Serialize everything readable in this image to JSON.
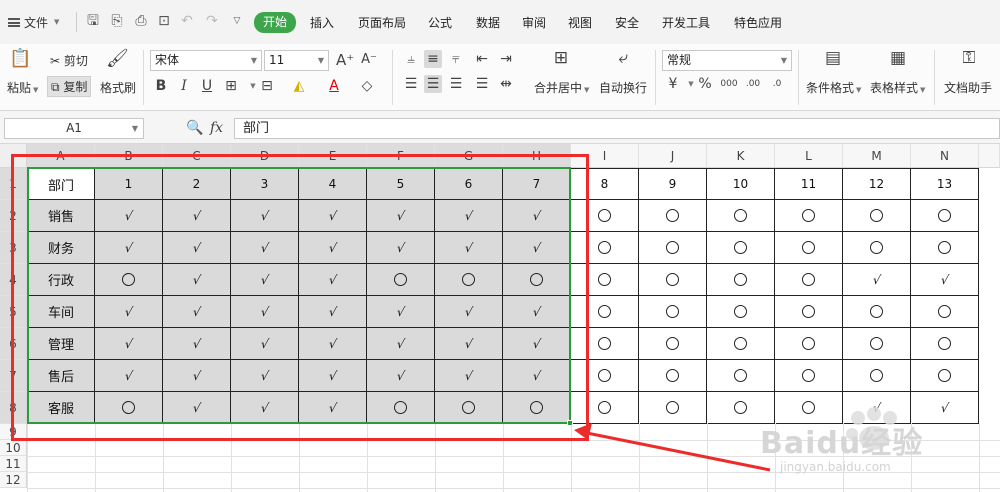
{
  "menubar": {
    "file_label": "文件",
    "tabs": [
      "开始",
      "插入",
      "页面布局",
      "公式",
      "数据",
      "审阅",
      "视图",
      "安全",
      "开发工具",
      "特色应用"
    ],
    "active_tab": "开始"
  },
  "ribbon": {
    "paste": "粘贴",
    "cut": "剪切",
    "copy": "复制",
    "format_painter": "格式刷",
    "font_name": "宋体",
    "font_size": "11",
    "merge_center": "合并居中",
    "wrap_text": "自动换行",
    "number_format": "常规",
    "conditional_format": "条件格式",
    "table_style": "表格样式",
    "doc_helper": "文档助手"
  },
  "formula_bar": {
    "cell_ref": "A1",
    "fx": "fx",
    "content": "部门"
  },
  "columns": [
    "A",
    "B",
    "C",
    "D",
    "E",
    "F",
    "G",
    "H",
    "I",
    "J",
    "K",
    "L",
    "M",
    "N"
  ],
  "rows": [
    "1",
    "2",
    "3",
    "4",
    "5",
    "6",
    "7",
    "8",
    "9",
    "10",
    "11",
    "12"
  ],
  "table": {
    "header": [
      "部门",
      "1",
      "2",
      "3",
      "4",
      "5",
      "6",
      "7",
      "8",
      "9",
      "10",
      "11",
      "12",
      "13"
    ],
    "body": [
      {
        "dept": "销售",
        "marks": [
          "check",
          "check",
          "check",
          "check",
          "check",
          "check",
          "check",
          "circle",
          "circle",
          "circle",
          "circle",
          "circle",
          "circle"
        ]
      },
      {
        "dept": "财务",
        "marks": [
          "check",
          "check",
          "check",
          "check",
          "check",
          "check",
          "check",
          "circle",
          "circle",
          "circle",
          "circle",
          "circle",
          "circle"
        ]
      },
      {
        "dept": "行政",
        "marks": [
          "circle",
          "check",
          "check",
          "check",
          "circle",
          "circle",
          "circle",
          "circle",
          "circle",
          "circle",
          "circle",
          "check",
          "check"
        ]
      },
      {
        "dept": "车间",
        "marks": [
          "check",
          "check",
          "check",
          "check",
          "check",
          "check",
          "check",
          "circle",
          "circle",
          "circle",
          "circle",
          "circle",
          "circle"
        ]
      },
      {
        "dept": "管理",
        "marks": [
          "check",
          "check",
          "check",
          "check",
          "check",
          "check",
          "check",
          "circle",
          "circle",
          "circle",
          "circle",
          "circle",
          "circle"
        ]
      },
      {
        "dept": "售后",
        "marks": [
          "check",
          "check",
          "check",
          "check",
          "check",
          "check",
          "check",
          "circle",
          "circle",
          "circle",
          "circle",
          "circle",
          "circle"
        ]
      },
      {
        "dept": "客服",
        "marks": [
          "circle",
          "check",
          "check",
          "check",
          "circle",
          "circle",
          "circle",
          "circle",
          "circle",
          "circle",
          "circle",
          "check",
          "check"
        ]
      }
    ]
  },
  "watermark": {
    "brand": "Baidu经验",
    "url": "jingyan.baidu.com"
  },
  "colors": {
    "accent_tab": "#3da54a",
    "selection_green": "#2a9d3a",
    "annotation_red": "#ee2b2b",
    "selected_fill": "#dadada"
  }
}
